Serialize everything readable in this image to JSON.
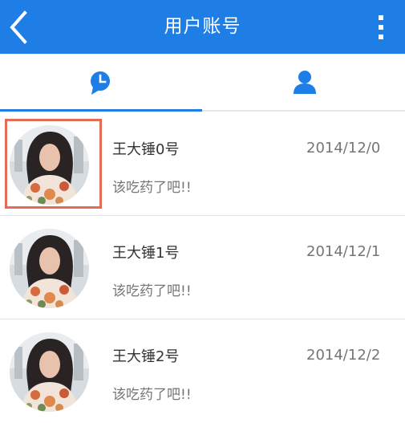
{
  "header": {
    "title": "用户账号",
    "back_icon": "chevron-left-icon",
    "menu_icon": "more-vertical-icon",
    "background_color": "#1e7ee6"
  },
  "tabs": [
    {
      "icon": "clock-chat-icon",
      "selected": true
    },
    {
      "icon": "person-icon",
      "selected": false
    }
  ],
  "accent_color": "#1e7ee6",
  "conversations": [
    {
      "name": "王大锤0号",
      "date": "2014/12/0",
      "message": "该吃药了吧!!",
      "highlighted": true
    },
    {
      "name": "王大锤1号",
      "date": "2014/12/1",
      "message": "该吃药了吧!!",
      "highlighted": false
    },
    {
      "name": "王大锤2号",
      "date": "2014/12/2",
      "message": "该吃药了吧!!",
      "highlighted": false
    }
  ]
}
